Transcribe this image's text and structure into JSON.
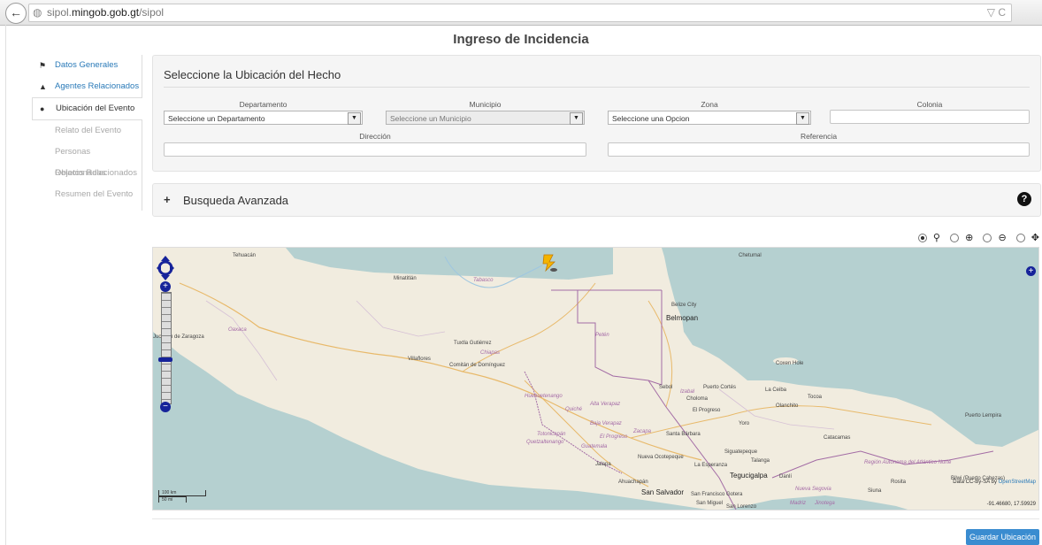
{
  "browser": {
    "url_prefix": "sipol.",
    "url_domain": "mingob.gob.gt",
    "url_path": "/sipol",
    "back_glyph": "←",
    "right_icons": "▽ C"
  },
  "page": {
    "title": "Ingreso de Incidencia"
  },
  "sidebar": {
    "items": [
      {
        "label": "Datos Generales",
        "icon": "flag-icon",
        "glyph": "⚑"
      },
      {
        "label": "Agentes Relacionados",
        "icon": "bell-icon",
        "glyph": "▲"
      },
      {
        "label": "Ubicación del Evento",
        "icon": "map-marker-icon",
        "glyph": "●"
      },
      {
        "label": "Relato del Evento"
      },
      {
        "label": "Personas Relacionadas"
      },
      {
        "label": "Objetos Relacionados"
      },
      {
        "label": "Resumen del Evento"
      }
    ]
  },
  "location_panel": {
    "title": "Seleccione la Ubicación del Hecho",
    "departamento": {
      "label": "Departamento",
      "value": "Seleccione un Departamento"
    },
    "municipio": {
      "label": "Municipio",
      "value": "Seleccione un Municipio"
    },
    "zona": {
      "label": "Zona",
      "value": "Seleccione una Opcion"
    },
    "colonia": {
      "label": "Colonia",
      "value": ""
    },
    "direccion": {
      "label": "Dirección",
      "value": ""
    },
    "referencia": {
      "label": "Referencia",
      "value": ""
    }
  },
  "advanced_search": {
    "toggle": "+",
    "label": "Busqueda Avanzada",
    "help": "?"
  },
  "map": {
    "labels": {
      "tehuacan": "Tehuacán",
      "minatitlan": "Minatitlán",
      "tabasco": "Tabasco",
      "chetumal": "Chetumal",
      "belize_city": "Belize City",
      "belmopan": "Belmopan",
      "oaxaca": "Oaxaca",
      "tuxtla": "Tuxtla Gutiérrez",
      "chiapas": "Chiapas",
      "peten": "Petén",
      "juchitan": "Juchitán de Zaragoza",
      "villaflores": "Villaflores",
      "comitan": "Comitán de Domínguez",
      "huehuetenango": "Huehuetenango",
      "quiche": "Quiché",
      "alta_verapaz": "Alta Verapaz",
      "baja_verapaz": "Baja Verapaz",
      "totonicapan": "Totonicapán",
      "quetzaltenango": "Quetzaltenango",
      "el_progreso_dept": "El Progreso",
      "zacapa": "Zacapa",
      "guatemala": "Guatemala",
      "jalapa": "Jalapa",
      "sebol": "Sebol",
      "izabal": "Izabal",
      "puerto_cortes": "Puerto Cortés",
      "la_ceiba": "La Ceiba",
      "tocoa": "Tocoa",
      "coxen_hole": "Coxen Hole",
      "choloma": "Choloma",
      "el_progreso_hn": "El Progreso",
      "olanchito": "Olanchito",
      "yoro": "Yoro",
      "santa_barbara": "Santa Bárbara",
      "catacamas": "Catacamas",
      "siguatepeque": "Siguatepeque",
      "talanga": "Talanga",
      "nueva_ocotepeque": "Nueva Ocotepeque",
      "la_esperanza": "La Esperanza",
      "tegucigalpa": "Tegucigalpa",
      "danli": "Danlí",
      "ahuachapan": "Ahuachapán",
      "san_salvador": "San Salvador",
      "san_francisco_gotera": "San Francisco Gotera",
      "san_miguel": "San Miguel",
      "san_lorenzo": "San Lorenzo",
      "nueva_segovia": "Nueva Segovia",
      "madriz": "Madriz",
      "jinotega": "Jinotega",
      "siuna": "Siuna",
      "region_atlantico": "Región Autónoma del Atlántico Norte",
      "puerto_lempira": "Puerto Lempira",
      "rosita": "Rosita",
      "bilwi": "Bilwi (Puerto Cabezas)"
    },
    "attribution_prefix": "Data CC-By-SA by ",
    "attribution_link": "OpenStreetMap",
    "coordinates": "-91.46680, 17.59929",
    "scale_top": "100 km",
    "scale_bottom": "50 mi"
  },
  "tools": {
    "items": [
      {
        "selected": true,
        "icon": "pin-icon",
        "glyph": "📍"
      },
      {
        "selected": false,
        "icon": "zoom-in-icon",
        "glyph": "🔍"
      },
      {
        "selected": false,
        "icon": "zoom-out-icon",
        "glyph": "🔍"
      },
      {
        "selected": false,
        "icon": "pan-icon",
        "glyph": "✥"
      }
    ]
  },
  "actions": {
    "save_label": "Guardar Ubicación"
  },
  "colors": {
    "accent": "#3a8cd0",
    "link": "#2a7ab8",
    "map_control": "#16239a",
    "sea": "#b5d0d0",
    "land": "#f0ead9"
  }
}
